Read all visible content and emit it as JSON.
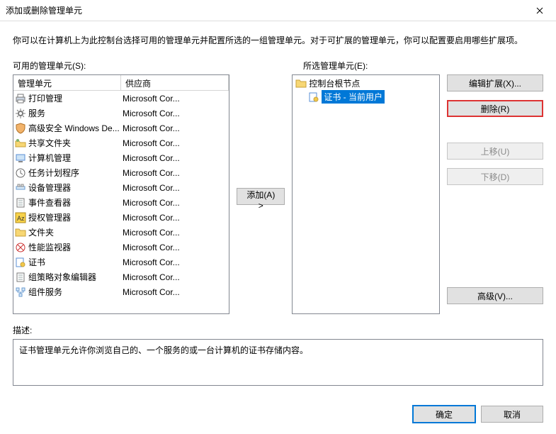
{
  "window": {
    "title": "添加或删除管理单元",
    "close_icon_name": "close-icon"
  },
  "intro": "你可以在计算机上为此控制台选择可用的管理单元并配置所选的一组管理单元。对于可扩展的管理单元，你可以配置要启用哪些扩展项。",
  "labels": {
    "available": "可用的管理单元(S):",
    "selected": "所选管理单元(E):",
    "description": "描述:"
  },
  "headers": {
    "snapin": "管理单元",
    "vendor": "供应商"
  },
  "available": [
    {
      "name": "打印管理",
      "vendor": "Microsoft Cor...",
      "icon": "printer-icon"
    },
    {
      "name": "服务",
      "vendor": "Microsoft Cor...",
      "icon": "gear-icon"
    },
    {
      "name": "高级安全 Windows De...",
      "vendor": "Microsoft Cor...",
      "icon": "firewall-icon"
    },
    {
      "name": "共享文件夹",
      "vendor": "Microsoft Cor...",
      "icon": "shared-folder-icon"
    },
    {
      "name": "计算机管理",
      "vendor": "Microsoft Cor...",
      "icon": "computer-mgmt-icon"
    },
    {
      "name": "任务计划程序",
      "vendor": "Microsoft Cor...",
      "icon": "clock-icon"
    },
    {
      "name": "设备管理器",
      "vendor": "Microsoft Cor...",
      "icon": "device-mgr-icon"
    },
    {
      "name": "事件查看器",
      "vendor": "Microsoft Cor...",
      "icon": "event-viewer-icon"
    },
    {
      "name": "授权管理器",
      "vendor": "Microsoft Cor...",
      "icon": "auth-mgr-icon"
    },
    {
      "name": "文件夹",
      "vendor": "Microsoft Cor...",
      "icon": "folder-icon"
    },
    {
      "name": "性能监视器",
      "vendor": "Microsoft Cor...",
      "icon": "perfmon-icon"
    },
    {
      "name": "证书",
      "vendor": "Microsoft Cor...",
      "icon": "certificate-icon"
    },
    {
      "name": "组策略对象编辑器",
      "vendor": "Microsoft Cor...",
      "icon": "gpo-editor-icon"
    },
    {
      "name": "组件服务",
      "vendor": "Microsoft Cor...",
      "icon": "component-svc-icon"
    }
  ],
  "tree": {
    "root": {
      "label": "控制台根节点",
      "icon": "folder-icon"
    },
    "children": [
      {
        "label": "证书 - 当前用户",
        "icon": "certificate-icon",
        "selected": true
      }
    ]
  },
  "buttons": {
    "add": "添加(A) >",
    "edit_ext": "编辑扩展(X)...",
    "remove": "删除(R)",
    "move_up": "上移(U)",
    "move_down": "下移(D)",
    "advanced": "高级(V)...",
    "ok": "确定",
    "cancel": "取消"
  },
  "description": "证书管理单元允许你浏览自己的、一个服务的或一台计算机的证书存储内容。"
}
